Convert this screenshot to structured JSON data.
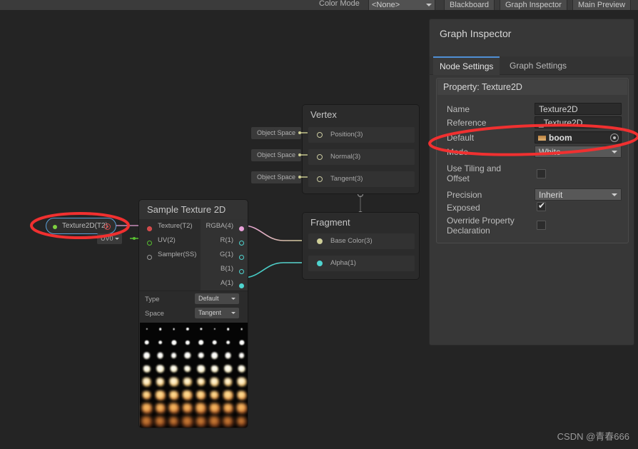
{
  "toolbar": {
    "color_mode_label": "Color Mode",
    "color_mode_value": "<None>",
    "blackboard_label": "Blackboard",
    "graph_inspector_label": "Graph Inspector",
    "main_preview_label": "Main Preview"
  },
  "inspector": {
    "title": "Graph Inspector",
    "tabs": [
      {
        "label": "Node Settings",
        "active": true
      },
      {
        "label": "Graph Settings",
        "active": false
      }
    ],
    "property": {
      "header": "Property: Texture2D",
      "rows": [
        {
          "label": "Name",
          "value": "Texture2D",
          "kind": "text"
        },
        {
          "label": "Reference",
          "value": "_Texture2D",
          "kind": "text"
        },
        {
          "label": "Default",
          "value": "boom",
          "kind": "object"
        },
        {
          "label": "Mode",
          "value": "White",
          "kind": "select"
        },
        {
          "label": "Use Tiling and\nOffset",
          "value": false,
          "kind": "checkbox"
        },
        {
          "label": "Precision",
          "value": "Inherit",
          "kind": "select"
        },
        {
          "label": "Exposed",
          "value": true,
          "kind": "checkbox"
        },
        {
          "label": "Override Property\nDeclaration",
          "value": false,
          "kind": "checkbox"
        }
      ]
    }
  },
  "graph": {
    "vertex_node": {
      "title": "Vertex",
      "slots": [
        {
          "label": "Position(3)",
          "space": "Object Space"
        },
        {
          "label": "Normal(3)",
          "space": "Object Space"
        },
        {
          "label": "Tangent(3)",
          "space": "Object Space"
        }
      ]
    },
    "fragment_node": {
      "title": "Fragment",
      "slots": [
        {
          "label": "Base Color(3)"
        },
        {
          "label": "Alpha(1)"
        }
      ]
    },
    "sample_texture_node": {
      "title": "Sample Texture 2D",
      "inputs": [
        {
          "label": "Texture(T2)"
        },
        {
          "label": "UV(2)"
        },
        {
          "label": "Sampler(SS)"
        }
      ],
      "outputs": [
        {
          "label": "RGBA(4)"
        },
        {
          "label": "R(1)"
        },
        {
          "label": "G(1)"
        },
        {
          "label": "B(1)"
        },
        {
          "label": "A(1)"
        }
      ],
      "settings": [
        {
          "label": "Type",
          "value": "Default"
        },
        {
          "label": "Space",
          "value": "Tangent"
        }
      ]
    },
    "texture_property_node": {
      "label": "Texture2D(T2)"
    },
    "uv_node": {
      "value": "UV0"
    }
  },
  "preview": {
    "rows": 8,
    "cols": 8,
    "description": "explosion-sprite-sheet"
  },
  "annotations": {
    "ellipse_color": "#f03030",
    "count": 2
  },
  "watermark": "CSDN @青春666",
  "colors": {
    "background": "#242424",
    "panel": "#373737",
    "accent": "#4f8fd4",
    "node_border_selected": "#5aa0d8",
    "wire_yellow": "#cfcf93",
    "wire_teal": "#4fd4cf",
    "wire_pink": "#e8a0d8",
    "annotation_red": "#f03030"
  }
}
